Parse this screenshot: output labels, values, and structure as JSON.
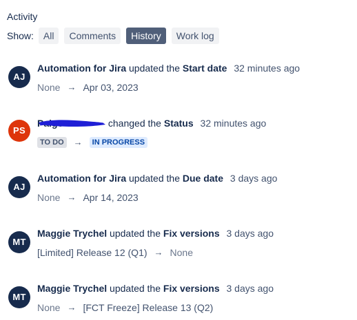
{
  "activity": {
    "title": "Activity",
    "show_label": "Show:",
    "filters": [
      {
        "label": "All",
        "active": false
      },
      {
        "label": "Comments",
        "active": false
      },
      {
        "label": "History",
        "active": true
      },
      {
        "label": "Work log",
        "active": false
      }
    ]
  },
  "entries": [
    {
      "avatar_initials": "AJ",
      "avatar_color": "#172b4d",
      "actor": "Automation for Jira",
      "verb": "updated the",
      "field": "Start date",
      "time": "32 minutes ago",
      "from": "None",
      "to": "Apr 03, 2023"
    },
    {
      "avatar_initials": "PS",
      "avatar_color": "#de350b",
      "actor": "Paige",
      "verb": "changed the",
      "field": "Status",
      "time": "32 minutes ago",
      "from": "TO DO",
      "to": "IN PROGRESS"
    },
    {
      "avatar_initials": "AJ",
      "avatar_color": "#172b4d",
      "actor": "Automation for Jira",
      "verb": "updated the",
      "field": "Due date",
      "time": "3 days ago",
      "from": "None",
      "to": "Apr 14, 2023"
    },
    {
      "avatar_initials": "MT",
      "avatar_color": "#172b4d",
      "actor": "Maggie Trychel",
      "verb": "updated the",
      "field": "Fix versions",
      "time": "3 days ago",
      "from": "[Limited] Release 12 (Q1)",
      "to": "None"
    },
    {
      "avatar_initials": "MT",
      "avatar_color": "#172b4d",
      "actor": "Maggie Trychel",
      "verb": "updated the",
      "field": "Fix versions",
      "time": "3 days ago",
      "from": "None",
      "to": "[FCT Freeze] Release 13 (Q2)"
    }
  ],
  "arrow_glyph": "→",
  "colors": {
    "redaction": "#1f1fd6",
    "active_filter": "#505f79",
    "in_progress_lozenge": "#deebff",
    "todo_lozenge": "#dfe1e6"
  }
}
